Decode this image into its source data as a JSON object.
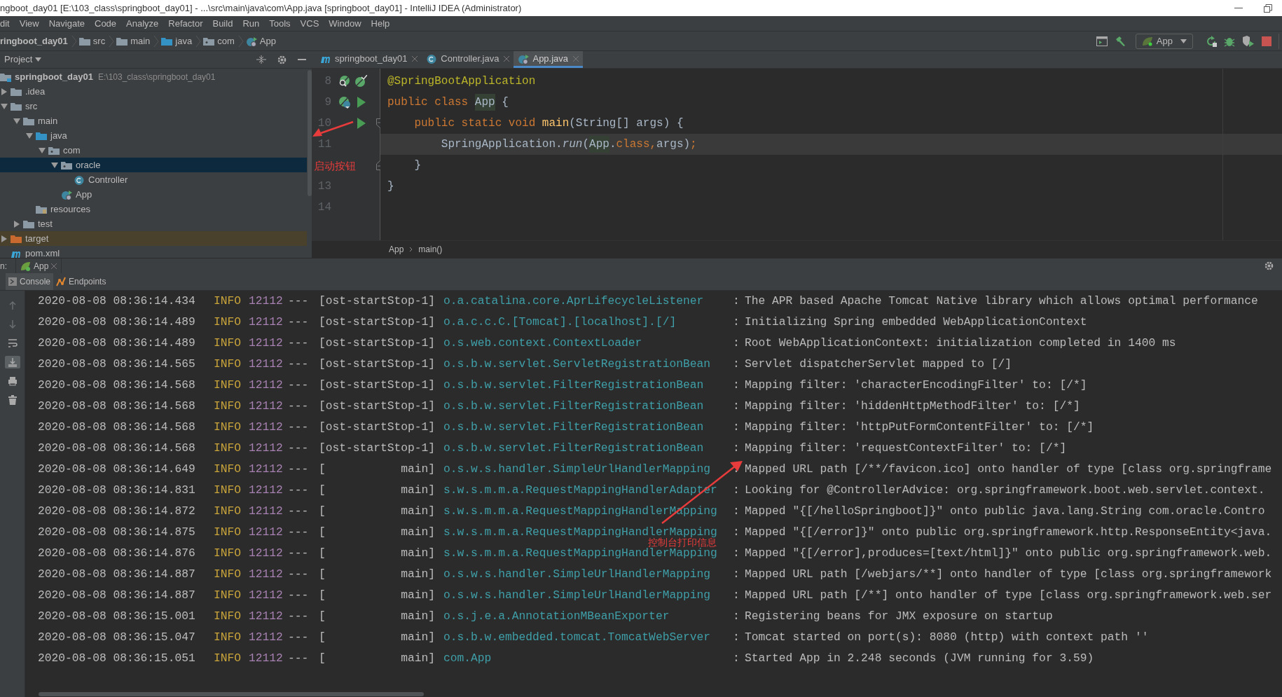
{
  "window": {
    "title": "ngboot_day01 [E:\\103_class\\springboot_day01] - ...\\src\\main\\java\\com\\App.java [springboot_day01] - IntelliJ IDEA (Administrator)"
  },
  "menu": [
    "dit",
    "View",
    "Navigate",
    "Code",
    "Analyze",
    "Refactor",
    "Build",
    "Run",
    "Tools",
    "VCS",
    "Window",
    "Help"
  ],
  "breadcrumbs": [
    {
      "label": "ringboot_day01"
    },
    {
      "label": "src",
      "kind": "folder"
    },
    {
      "label": "main",
      "kind": "folder"
    },
    {
      "label": "java",
      "kind": "source"
    },
    {
      "label": "com",
      "kind": "package"
    },
    {
      "label": "App",
      "kind": "app"
    }
  ],
  "run_config": {
    "label": "App"
  },
  "project_panel": {
    "title": "Project",
    "tree": [
      {
        "label": "springboot_day01",
        "path": "E:\\103_class\\springboot_day01",
        "kind": "module",
        "selected": false,
        "children": [
          {
            "label": ".idea",
            "kind": "folder",
            "expanded": false,
            "selected": false
          },
          {
            "label": "src",
            "kind": "folder",
            "expanded": true,
            "selected": false,
            "children": [
              {
                "label": "main",
                "kind": "folder",
                "expanded": true,
                "selected": false,
                "children": [
                  {
                    "label": "java",
                    "kind": "source",
                    "expanded": true,
                    "selected": false,
                    "children": [
                      {
                        "label": "com",
                        "kind": "package",
                        "expanded": true,
                        "selected": false,
                        "children": [
                          {
                            "label": "oracle",
                            "kind": "package",
                            "expanded": true,
                            "selected": true,
                            "children": [
                              {
                                "label": "Controller",
                                "kind": "class",
                                "selected": false
                              }
                            ]
                          },
                          {
                            "label": "App",
                            "kind": "app",
                            "selected": false
                          }
                        ]
                      }
                    ]
                  },
                  {
                    "label": "resources",
                    "kind": "resources",
                    "selected": false
                  }
                ]
              },
              {
                "label": "test",
                "kind": "folder",
                "expanded": false,
                "selected": false
              }
            ]
          },
          {
            "label": "target",
            "kind": "excluded",
            "expanded": false,
            "selected": false
          },
          {
            "label": "pom.xml",
            "kind": "maven",
            "selected": false
          }
        ]
      }
    ]
  },
  "editor_tabs": [
    {
      "label": "springboot_day01",
      "kind": "maven",
      "selected": false
    },
    {
      "label": "Controller.java",
      "kind": "class",
      "selected": false
    },
    {
      "label": "App.java",
      "kind": "app",
      "selected": true
    }
  ],
  "editor": {
    "lines": [
      {
        "number": "8",
        "current": false,
        "gutter": [
          {
            "kind": "spring-search"
          },
          {
            "kind": "spring-check"
          }
        ],
        "tokens": [
          {
            "text": "@SpringBootApplication",
            "kind": "annotation"
          }
        ]
      },
      {
        "number": "9",
        "current": false,
        "gutter": [
          {
            "kind": "spring-class"
          },
          {
            "kind": "run"
          }
        ],
        "tokens": [
          {
            "text": "public class ",
            "kind": "keyword"
          },
          {
            "text": "App",
            "kind": "highlight"
          },
          {
            "text": " {",
            "kind": "plain"
          }
        ]
      },
      {
        "number": "10",
        "current": false,
        "gutter": [
          {
            "kind": "run"
          }
        ],
        "fold": true,
        "tokens": [
          {
            "text": "    public static void ",
            "kind": "keyword"
          },
          {
            "text": "main",
            "kind": "method"
          },
          {
            "text": "(String[] args) {",
            "kind": "plain"
          }
        ]
      },
      {
        "number": "11",
        "current": true,
        "tokens": [
          {
            "text": "        SpringApplication.",
            "kind": "plain"
          },
          {
            "text": "run",
            "kind": "italic"
          },
          {
            "text": "(",
            "kind": "plain"
          },
          {
            "text": "App",
            "kind": "highlight"
          },
          {
            "text": ".",
            "kind": "plain"
          },
          {
            "text": "class,",
            "kind": "keyword"
          },
          {
            "text": "args)",
            "kind": "plain"
          },
          {
            "text": ";",
            "kind": "keyword"
          }
        ]
      },
      {
        "current": false,
        "fold": true,
        "tokens": [
          {
            "text": "    }",
            "kind": "plain"
          }
        ]
      },
      {
        "number": "13",
        "current": false,
        "tokens": [
          {
            "text": "}",
            "kind": "plain"
          }
        ]
      },
      {
        "number": "14",
        "current": false
      }
    ],
    "breadcrumb": [
      "App",
      "main()"
    ]
  },
  "run_panel": {
    "prefix": "n:",
    "tab": "App",
    "tabs": [
      {
        "label": "Console",
        "kind": "console",
        "selected": true
      },
      {
        "label": "Endpoints",
        "kind": "endpoints",
        "selected": false
      }
    ]
  },
  "console": {
    "toolbar": [
      {
        "kind": "up",
        "on": false
      },
      {
        "kind": "down",
        "on": false
      },
      {
        "kind": "wrap",
        "on": false
      },
      {
        "kind": "scroll-end",
        "on": true
      },
      {
        "kind": "print",
        "on": false
      },
      {
        "kind": "trash",
        "on": false
      }
    ],
    "rows": [
      {
        "time": "2020-08-08 08:36:14.434",
        "level": "INFO",
        "pid": "12112",
        "sep": "---",
        "thread": "[ost-startStop-1]",
        "logger": "o.a.catalina.core.AprLifecycleListener",
        "colon": ":",
        "message": "The APR based Apache Tomcat Native library which allows optimal performance"
      },
      {
        "time": "2020-08-08 08:36:14.489",
        "level": "INFO",
        "pid": "12112",
        "sep": "---",
        "thread": "[ost-startStop-1]",
        "logger": "o.a.c.c.C.[Tomcat].[localhost].[/]",
        "colon": ":",
        "message": "Initializing Spring embedded WebApplicationContext"
      },
      {
        "time": "2020-08-08 08:36:14.489",
        "level": "INFO",
        "pid": "12112",
        "sep": "---",
        "thread": "[ost-startStop-1]",
        "logger": "o.s.web.context.ContextLoader",
        "colon": ":",
        "message": "Root WebApplicationContext: initialization completed in 1400 ms"
      },
      {
        "time": "2020-08-08 08:36:14.565",
        "level": "INFO",
        "pid": "12112",
        "sep": "---",
        "thread": "[ost-startStop-1]",
        "logger": "o.s.b.w.servlet.ServletRegistrationBean",
        "colon": ":",
        "message": "Servlet dispatcherServlet mapped to [/]"
      },
      {
        "time": "2020-08-08 08:36:14.568",
        "level": "INFO",
        "pid": "12112",
        "sep": "---",
        "thread": "[ost-startStop-1]",
        "logger": "o.s.b.w.servlet.FilterRegistrationBean",
        "colon": ":",
        "message": "Mapping filter: 'characterEncodingFilter' to: [/*]"
      },
      {
        "time": "2020-08-08 08:36:14.568",
        "level": "INFO",
        "pid": "12112",
        "sep": "---",
        "thread": "[ost-startStop-1]",
        "logger": "o.s.b.w.servlet.FilterRegistrationBean",
        "colon": ":",
        "message": "Mapping filter: 'hiddenHttpMethodFilter' to: [/*]"
      },
      {
        "time": "2020-08-08 08:36:14.568",
        "level": "INFO",
        "pid": "12112",
        "sep": "---",
        "thread": "[ost-startStop-1]",
        "logger": "o.s.b.w.servlet.FilterRegistrationBean",
        "colon": ":",
        "message": "Mapping filter: 'httpPutFormContentFilter' to: [/*]"
      },
      {
        "time": "2020-08-08 08:36:14.568",
        "level": "INFO",
        "pid": "12112",
        "sep": "---",
        "thread": "[ost-startStop-1]",
        "logger": "o.s.b.w.servlet.FilterRegistrationBean",
        "colon": ":",
        "message": "Mapping filter: 'requestContextFilter' to: [/*]"
      },
      {
        "time": "2020-08-08 08:36:14.649",
        "level": "INFO",
        "pid": "12112",
        "sep": "---",
        "thread": "[           main]",
        "logger": "o.s.w.s.handler.SimpleUrlHandlerMapping",
        "colon": ":",
        "message": "Mapped URL path [/**/favicon.ico] onto handler of type [class org.springframe"
      },
      {
        "time": "2020-08-08 08:36:14.831",
        "level": "INFO",
        "pid": "12112",
        "sep": "---",
        "thread": "[           main]",
        "logger": "s.w.s.m.m.a.RequestMappingHandlerAdapter",
        "colon": ":",
        "message": "Looking for @ControllerAdvice: org.springframework.boot.web.servlet.context."
      },
      {
        "time": "2020-08-08 08:36:14.872",
        "level": "INFO",
        "pid": "12112",
        "sep": "---",
        "thread": "[           main]",
        "logger": "s.w.s.m.m.a.RequestMappingHandlerMapping",
        "colon": ":",
        "message": "Mapped \"{[/helloSpringboot]}\" onto public java.lang.String com.oracle.Contro"
      },
      {
        "time": "2020-08-08 08:36:14.875",
        "level": "INFO",
        "pid": "12112",
        "sep": "---",
        "thread": "[           main]",
        "logger": "s.w.s.m.m.a.RequestMappingHandlerMapping",
        "colon": ":",
        "message": "Mapped \"{[/error]}\" onto public org.springframework.http.ResponseEntity<java."
      },
      {
        "time": "2020-08-08 08:36:14.876",
        "level": "INFO",
        "pid": "12112",
        "sep": "---",
        "thread": "[           main]",
        "logger": "s.w.s.m.m.a.RequestMappingHandlerMapping",
        "colon": ":",
        "message": "Mapped \"{[/error],produces=[text/html]}\" onto public org.springframework.web."
      },
      {
        "time": "2020-08-08 08:36:14.887",
        "level": "INFO",
        "pid": "12112",
        "sep": "---",
        "thread": "[           main]",
        "logger": "o.s.w.s.handler.SimpleUrlHandlerMapping",
        "colon": ":",
        "message": "Mapped URL path [/webjars/**] onto handler of type [class org.springframework"
      },
      {
        "time": "2020-08-08 08:36:14.887",
        "level": "INFO",
        "pid": "12112",
        "sep": "---",
        "thread": "[           main]",
        "logger": "o.s.w.s.handler.SimpleUrlHandlerMapping",
        "colon": ":",
        "message": "Mapped URL path [/**] onto handler of type [class org.springframework.web.ser"
      },
      {
        "time": "2020-08-08 08:36:15.001",
        "level": "INFO",
        "pid": "12112",
        "sep": "---",
        "thread": "[           main]",
        "logger": "o.s.j.e.a.AnnotationMBeanExporter",
        "colon": ":",
        "message": "Registering beans for JMX exposure on startup"
      },
      {
        "time": "2020-08-08 08:36:15.047",
        "level": "INFO",
        "pid": "12112",
        "sep": "---",
        "thread": "[           main]",
        "logger": "o.s.b.w.embedded.tomcat.TomcatWebServer",
        "colon": ":",
        "message": "Tomcat started on port(s): 8080 (http) with context path ''"
      },
      {
        "time": "2020-08-08 08:36:15.051",
        "level": "INFO",
        "pid": "12112",
        "sep": "---",
        "thread": "[           main]",
        "logger": "com.App",
        "colon": ":",
        "message": "Started App in 2.248 seconds (JVM running for 3.59)"
      }
    ]
  },
  "annotations": [
    {
      "text": "启动按钮",
      "kind": "gutter"
    },
    {
      "text": "控制台打印信息",
      "kind": "console"
    }
  ]
}
